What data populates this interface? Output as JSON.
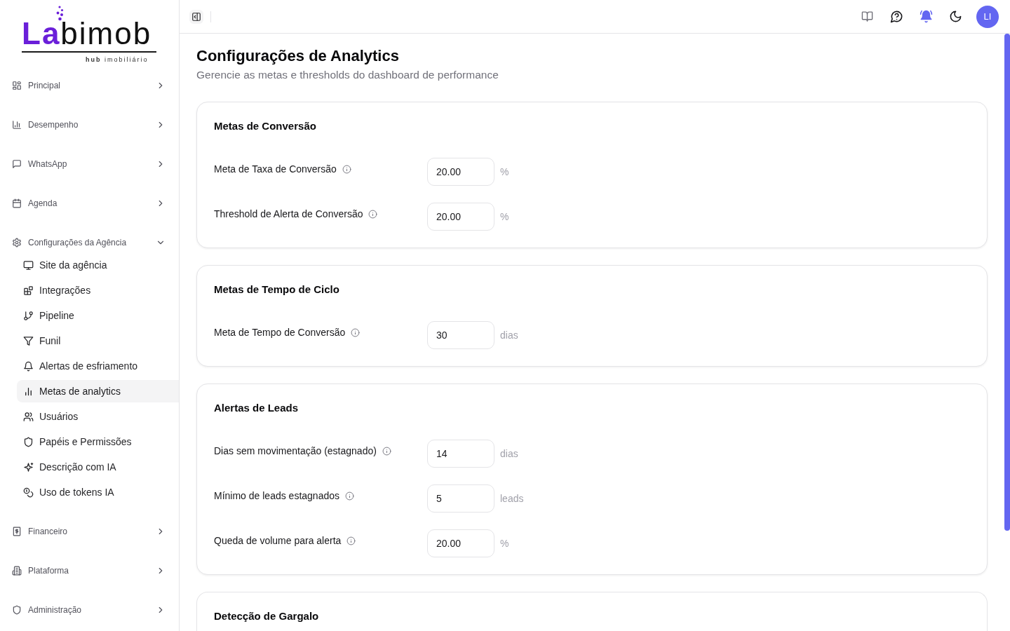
{
  "sidebar": {
    "logo": {
      "accent": "La",
      "rest": "bimob",
      "tagline": "**hub** imobiliário"
    },
    "items": [
      {
        "label": "Principal",
        "expanded": false
      },
      {
        "label": "Desempenho",
        "expanded": false
      },
      {
        "label": "WhatsApp",
        "expanded": false
      },
      {
        "label": "Agenda",
        "expanded": false
      },
      {
        "label": "Configurações da Agência",
        "expanded": true,
        "children": [
          {
            "label": "Site da agência",
            "selected": false
          },
          {
            "label": "Integrações",
            "selected": false
          },
          {
            "label": "Pipeline",
            "selected": false
          },
          {
            "label": "Funil",
            "selected": false
          },
          {
            "label": "Alertas de esfriamento",
            "selected": false
          },
          {
            "label": "Metas de analytics",
            "selected": true
          },
          {
            "label": "Usuários",
            "selected": false
          },
          {
            "label": "Papéis e Permissões",
            "selected": false
          },
          {
            "label": "Descrição com IA",
            "selected": false
          },
          {
            "label": "Uso de tokens IA",
            "selected": false
          }
        ]
      },
      {
        "label": "Financeiro",
        "expanded": false
      },
      {
        "label": "Plataforma",
        "expanded": false
      },
      {
        "label": "Administração",
        "expanded": false
      }
    ]
  },
  "topbar": {
    "notifications_unread": true,
    "avatar": "LI"
  },
  "page": {
    "title": "Configurações de Analytics",
    "subtitle": "Gerencie as metas e thresholds do dashboard de performance"
  },
  "sections": [
    {
      "title": "Metas de Conversão",
      "fields": [
        {
          "label": "Meta de Taxa de Conversão",
          "value": "20.00",
          "unit": "%"
        },
        {
          "label": "Threshold de Alerta de Conversão",
          "value": "20.00",
          "unit": "%"
        }
      ]
    },
    {
      "title": "Metas de Tempo de Ciclo",
      "fields": [
        {
          "label": "Meta de Tempo de Conversão",
          "value": "30",
          "unit": "dias"
        }
      ]
    },
    {
      "title": "Alertas de Leads",
      "fields": [
        {
          "label": "Dias sem movimentação (estagnado)",
          "value": "14",
          "unit": "dias"
        },
        {
          "label": "Mínimo de leads estagnados",
          "value": "5",
          "unit": "leads"
        },
        {
          "label": "Queda de volume para alerta",
          "value": "20.00",
          "unit": "%"
        }
      ]
    },
    {
      "title": "Detecção de Gargalo"
    }
  ]
}
